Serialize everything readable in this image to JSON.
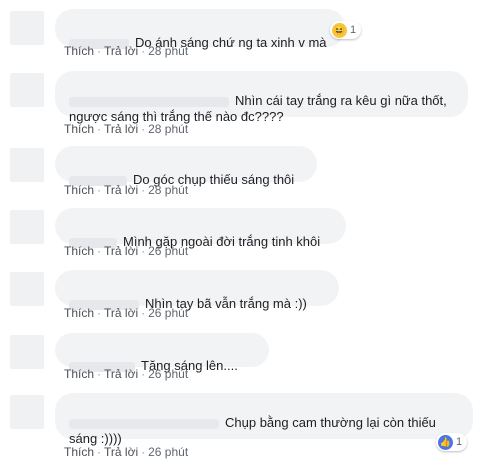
{
  "comments": [
    {
      "text": "Do ánh sáng chứ ng ta xinh v mà",
      "reaction": {
        "icon": "haha-icon",
        "count": "1"
      },
      "like": "Thích",
      "reply": "Trả lời",
      "time": "28 phút"
    },
    {
      "text": "Nhìn cái tay trắng   ra kêu gì nữa thốt, ngược sáng thì trắng thế nào đc????",
      "like": "Thích",
      "reply": "Trả lời",
      "time": "28 phút"
    },
    {
      "text": "Do góc chụp thiếu sáng thôi",
      "like": "Thích",
      "reply": "Trả lời",
      "time": "28 phút"
    },
    {
      "text": "Mình gặp ngoài đời trắng tinh khôi",
      "like": "Thích",
      "reply": "Trả lời",
      "time": "26 phút"
    },
    {
      "text": "Nhìn tay bã vẫn trắng mà :))",
      "like": "Thích",
      "reply": "Trả lời",
      "time": "26 phút"
    },
    {
      "text": "Tăng sáng lên....",
      "like": "Thích",
      "reply": "Trả lời",
      "time": "26 phút"
    },
    {
      "text": "Chụp bằng cam thường lại còn thiếu sáng :))))",
      "reaction": {
        "icon": "like-icon",
        "count": "1"
      },
      "like": "Thích",
      "reply": "Trả lời",
      "time": "26 phút"
    }
  ],
  "colors": {
    "bubble": "#f2f3f5",
    "action_text": "#4b4f56",
    "like_blue": "#4a76e8",
    "haha_yellow": "#f7c43c"
  }
}
